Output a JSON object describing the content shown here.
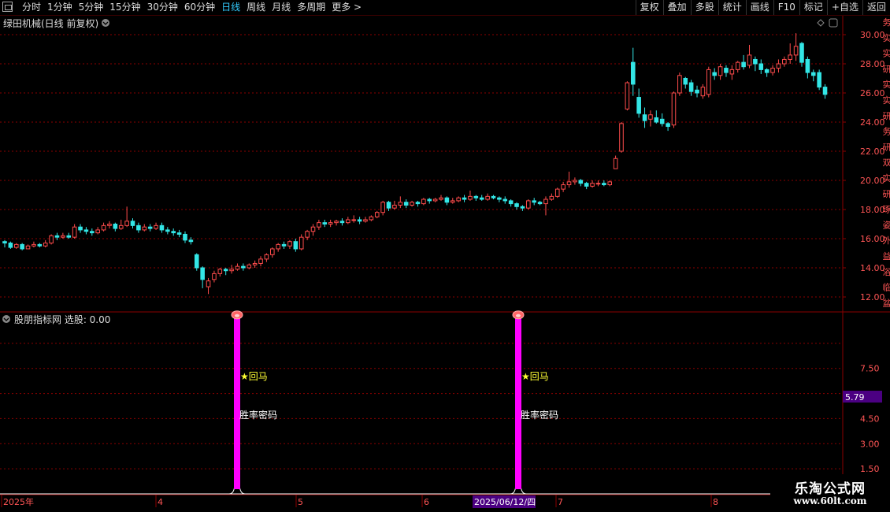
{
  "toolbar": {
    "period_tabs": [
      "分时",
      "1分钟",
      "5分钟",
      "15分钟",
      "30分钟",
      "60分钟",
      "日线",
      "周线",
      "月线",
      "多周期",
      "更多 >"
    ],
    "active_index": 6,
    "right_buttons": [
      "复权",
      "叠加",
      "多股",
      "统计",
      "画线",
      "F10",
      "标记",
      "+自选",
      "返回"
    ]
  },
  "main_chart": {
    "title": "绿田机械(日线 前复权)",
    "y_ticks": [
      "30.00",
      "28.00",
      "26.00",
      "24.00",
      "22.00",
      "20.00",
      "18.00",
      "16.00",
      "14.00",
      "12.00"
    ]
  },
  "indicator": {
    "title": "股朋指标网 选股: 0.00",
    "y_ticks": [
      "7.50",
      "4.50",
      "3.00",
      "1.50"
    ],
    "current_value": "5.79",
    "signal_label": "★回马",
    "signal_text": "胜率密码"
  },
  "time_axis": {
    "labels": [
      "2025年",
      "4",
      "5",
      "6",
      "7",
      "8"
    ],
    "cursor_date": "2025/06/12/四"
  },
  "watermark": {
    "title": "乐淘公式网",
    "url": "www.60lt.com"
  },
  "side_strip_text": "务实实研实实研务研双实研琢姿外益浴临盆",
  "colors": {
    "up": "#ff4c4c",
    "down": "#33e6e6",
    "grid": "#8b0000",
    "signal": "#ff00ff",
    "accent": "#33ccff",
    "label_yellow": "#ffff33"
  },
  "chart_data": {
    "type": "candlestick",
    "x_axis": [
      "2025年",
      "4",
      "5",
      "6",
      "7",
      "8"
    ],
    "y_range": [
      11.5,
      30.5
    ],
    "candles": [
      [
        15.8,
        15.7,
        15.9,
        15.4
      ],
      [
        15.7,
        15.4,
        15.8,
        15.3
      ],
      [
        15.4,
        15.6,
        15.7,
        15.3
      ],
      [
        15.6,
        15.3,
        15.7,
        15.2
      ],
      [
        15.3,
        15.5,
        15.6,
        15.3
      ],
      [
        15.5,
        15.6,
        15.8,
        15.4
      ],
      [
        15.6,
        15.5,
        15.7,
        15.4
      ],
      [
        15.5,
        15.7,
        15.9,
        15.4
      ],
      [
        15.7,
        16.2,
        16.3,
        15.6
      ],
      [
        16.2,
        16.1,
        16.4,
        15.9
      ],
      [
        16.1,
        16.2,
        16.4,
        16.0
      ],
      [
        16.2,
        16.1,
        16.4,
        16.0
      ],
      [
        16.1,
        16.8,
        17.0,
        16.0
      ],
      [
        16.8,
        16.6,
        17.0,
        16.4
      ],
      [
        16.6,
        16.5,
        16.8,
        16.3
      ],
      [
        16.5,
        16.4,
        16.7,
        16.2
      ],
      [
        16.4,
        16.6,
        16.8,
        16.3
      ],
      [
        16.6,
        16.9,
        17.1,
        16.5
      ],
      [
        16.9,
        17.0,
        17.2,
        16.7
      ],
      [
        17.0,
        16.7,
        17.1,
        16.5
      ],
      [
        16.7,
        16.9,
        17.3,
        16.6
      ],
      [
        16.9,
        17.2,
        18.2,
        16.8
      ],
      [
        17.2,
        16.9,
        17.4,
        16.7
      ],
      [
        16.9,
        16.6,
        17.1,
        16.4
      ],
      [
        16.6,
        16.8,
        17.0,
        16.5
      ],
      [
        16.8,
        16.7,
        17.0,
        16.5
      ],
      [
        16.7,
        16.9,
        17.1,
        16.6
      ],
      [
        16.9,
        16.6,
        17.1,
        16.4
      ],
      [
        16.6,
        16.5,
        16.8,
        16.3
      ],
      [
        16.5,
        16.4,
        16.7,
        16.2
      ],
      [
        16.4,
        16.3,
        16.6,
        16.1
      ],
      [
        16.3,
        15.9,
        16.5,
        15.7
      ],
      [
        15.9,
        15.8,
        16.1,
        15.6
      ],
      [
        14.9,
        14.0,
        15.0,
        13.8
      ],
      [
        14.0,
        13.2,
        14.1,
        12.6
      ],
      [
        12.7,
        13.1,
        13.3,
        12.2
      ],
      [
        13.2,
        13.6,
        13.8,
        13.0
      ],
      [
        13.6,
        13.9,
        14.0,
        13.4
      ],
      [
        13.9,
        13.8,
        14.0,
        13.5
      ],
      [
        13.8,
        13.9,
        14.2,
        13.6
      ],
      [
        13.9,
        14.1,
        14.3,
        13.8
      ],
      [
        14.1,
        14.0,
        14.3,
        13.8
      ],
      [
        14.0,
        14.2,
        14.3,
        13.9
      ],
      [
        14.2,
        14.3,
        14.5,
        14.0
      ],
      [
        14.3,
        14.6,
        14.8,
        14.1
      ],
      [
        14.6,
        14.9,
        15.0,
        14.4
      ],
      [
        14.9,
        15.3,
        15.4,
        14.7
      ],
      [
        15.3,
        15.6,
        15.7,
        15.1
      ],
      [
        15.6,
        15.5,
        15.8,
        15.3
      ],
      [
        15.5,
        15.8,
        15.9,
        15.3
      ],
      [
        15.8,
        15.3,
        16.0,
        15.1
      ],
      [
        15.3,
        16.1,
        16.3,
        15.2
      ],
      [
        16.1,
        16.5,
        16.6,
        15.9
      ],
      [
        16.5,
        16.8,
        17.0,
        16.2
      ],
      [
        16.8,
        17.1,
        17.3,
        16.6
      ],
      [
        17.1,
        17.0,
        17.3,
        16.8
      ],
      [
        17.0,
        17.1,
        17.3,
        16.8
      ],
      [
        17.1,
        17.2,
        17.3,
        16.9
      ],
      [
        17.2,
        17.1,
        17.4,
        16.9
      ],
      [
        17.1,
        17.3,
        17.5,
        17.0
      ],
      [
        17.3,
        17.3,
        17.6,
        17.1
      ],
      [
        17.3,
        17.2,
        17.5,
        17.0
      ],
      [
        17.2,
        17.3,
        17.5,
        17.1
      ],
      [
        17.3,
        17.5,
        17.6,
        17.2
      ],
      [
        17.5,
        17.8,
        17.9,
        17.4
      ],
      [
        17.8,
        18.5,
        18.6,
        17.6
      ],
      [
        18.5,
        18.1,
        18.6,
        17.9
      ],
      [
        18.1,
        18.3,
        18.6,
        18.0
      ],
      [
        18.3,
        18.5,
        18.9,
        18.1
      ],
      [
        18.5,
        18.3,
        18.7,
        18.1
      ],
      [
        18.3,
        18.5,
        18.6,
        18.2
      ],
      [
        18.5,
        18.4,
        18.6,
        18.2
      ],
      [
        18.4,
        18.7,
        18.8,
        18.3
      ],
      [
        18.7,
        18.6,
        18.8,
        18.4
      ],
      [
        18.6,
        18.7,
        18.8,
        18.5
      ],
      [
        18.7,
        18.8,
        19.0,
        18.6
      ],
      [
        18.8,
        18.5,
        18.9,
        18.3
      ],
      [
        18.5,
        18.6,
        18.8,
        18.4
      ],
      [
        18.6,
        18.8,
        18.9,
        18.5
      ],
      [
        18.8,
        18.7,
        19.0,
        18.5
      ],
      [
        18.7,
        18.9,
        19.3,
        18.6
      ],
      [
        18.9,
        18.8,
        19.0,
        18.6
      ],
      [
        18.8,
        18.7,
        19.0,
        18.6
      ],
      [
        18.7,
        18.9,
        19.1,
        18.6
      ],
      [
        18.9,
        18.8,
        19.0,
        18.7
      ],
      [
        18.8,
        18.7,
        18.9,
        18.5
      ],
      [
        18.7,
        18.6,
        18.9,
        18.4
      ],
      [
        18.6,
        18.4,
        18.7,
        18.2
      ],
      [
        18.4,
        18.2,
        18.5,
        18.0
      ],
      [
        18.2,
        18.1,
        18.3,
        17.9
      ],
      [
        18.1,
        18.6,
        18.7,
        18.0
      ],
      [
        18.6,
        18.5,
        18.8,
        18.3
      ],
      [
        18.5,
        18.4,
        18.6,
        18.3
      ],
      [
        18.4,
        18.7,
        18.9,
        17.6
      ],
      [
        18.7,
        18.9,
        19.1,
        18.6
      ],
      [
        18.9,
        19.4,
        19.5,
        18.8
      ],
      [
        19.4,
        19.7,
        19.9,
        19.2
      ],
      [
        19.7,
        19.9,
        20.6,
        19.5
      ],
      [
        19.9,
        20.0,
        20.2,
        19.7
      ],
      [
        20.0,
        19.8,
        20.1,
        19.6
      ],
      [
        19.8,
        19.6,
        19.9,
        19.4
      ],
      [
        19.6,
        19.8,
        20.0,
        19.5
      ],
      [
        19.8,
        19.8,
        20.0,
        19.6
      ],
      [
        19.8,
        19.7,
        20.0,
        19.6
      ],
      [
        19.7,
        19.9,
        20.0,
        19.6
      ],
      [
        20.8,
        21.5,
        21.7,
        20.9
      ],
      [
        22.0,
        23.9,
        24.0,
        21.9
      ],
      [
        24.9,
        26.7,
        26.8,
        24.8
      ],
      [
        28.1,
        26.6,
        29.1,
        25.8
      ],
      [
        25.7,
        24.6,
        26.3,
        24.3
      ],
      [
        24.5,
        24.1,
        25.0,
        23.6
      ],
      [
        24.2,
        24.5,
        24.8,
        23.7
      ],
      [
        24.3,
        24.0,
        24.8,
        23.9
      ],
      [
        24.2,
        23.9,
        24.6,
        23.7
      ],
      [
        23.9,
        23.7,
        24.0,
        23.4
      ],
      [
        23.8,
        26.0,
        26.1,
        23.6
      ],
      [
        26.0,
        27.2,
        27.4,
        25.8
      ],
      [
        27.0,
        26.6,
        27.1,
        26.3
      ],
      [
        26.7,
        26.1,
        26.9,
        25.8
      ],
      [
        26.2,
        26.0,
        26.5,
        25.7
      ],
      [
        25.8,
        26.4,
        26.6,
        25.6
      ],
      [
        25.9,
        27.6,
        27.8,
        25.7
      ],
      [
        27.4,
        27.2,
        27.7,
        26.9
      ],
      [
        27.2,
        27.8,
        28.0,
        26.9
      ],
      [
        27.7,
        27.4,
        27.9,
        27.1
      ],
      [
        27.3,
        27.6,
        27.9,
        26.9
      ],
      [
        27.6,
        28.1,
        28.2,
        27.4
      ],
      [
        28.1,
        27.8,
        28.6,
        27.6
      ],
      [
        27.9,
        28.6,
        29.3,
        27.7
      ],
      [
        28.3,
        28.0,
        28.5,
        27.5
      ],
      [
        28.0,
        27.6,
        28.3,
        27.3
      ],
      [
        27.6,
        27.4,
        27.7,
        27.1
      ],
      [
        27.4,
        27.7,
        27.9,
        27.2
      ],
      [
        27.7,
        28.0,
        28.3,
        27.4
      ],
      [
        28.0,
        28.3,
        28.5,
        27.8
      ],
      [
        28.3,
        28.6,
        29.4,
        28.0
      ],
      [
        28.6,
        29.2,
        30.1,
        28.2
      ],
      [
        29.4,
        28.1,
        29.5,
        27.8
      ],
      [
        28.3,
        27.4,
        28.5,
        27.0
      ],
      [
        27.4,
        27.2,
        27.6,
        26.8
      ],
      [
        27.4,
        26.4,
        27.6,
        26.2
      ],
      [
        26.4,
        25.9,
        26.6,
        25.6
      ]
    ],
    "indicator_signals": [
      {
        "x_label": "4",
        "value": 10.7
      },
      {
        "x_label": "6",
        "value": 10.7
      }
    ],
    "indicator_y_range": [
      0,
      10.5
    ]
  }
}
